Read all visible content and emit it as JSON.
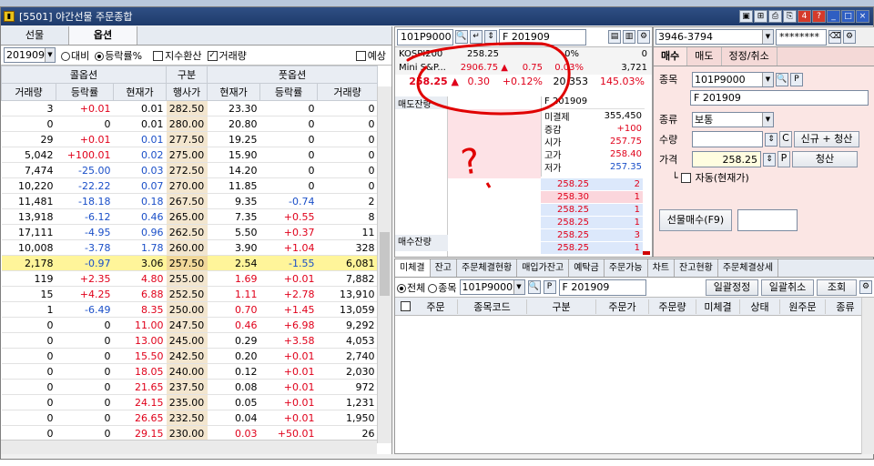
{
  "window": {
    "title": "[5501] 야간선물 주문종합",
    "icon": "app-icon",
    "title_buttons": [
      "▣",
      "⊞",
      "⎙",
      "⎘",
      "4",
      "?",
      "_",
      "□",
      "×"
    ]
  },
  "left": {
    "tabs": [
      "선물",
      "옵션"
    ],
    "month": "201909",
    "radio_daebi": "대비",
    "radio_rate": "등락률%",
    "chk_index": "지수환산",
    "chk_volume": "거래량",
    "chk_expect": "예상",
    "group_headers": {
      "call": "콜옵션",
      "center": "구분",
      "put": "풋옵션"
    },
    "col_headers": [
      "거래량",
      "등락률",
      "현재가",
      "행사가",
      "현재가",
      "등락률",
      "거래량"
    ],
    "rows": [
      [
        "3",
        "+0.01",
        "0.01",
        "282.50",
        "23.30",
        "0",
        "0"
      ],
      [
        "0",
        "0",
        "0.01",
        "280.00",
        "20.80",
        "0",
        "0"
      ],
      [
        "29",
        "+0.01",
        "0.01",
        "277.50",
        "19.25",
        "0",
        "0"
      ],
      [
        "5,042",
        "+100.01",
        "0.02",
        "275.00",
        "15.90",
        "0",
        "0"
      ],
      [
        "7,474",
        "-25.00",
        "0.03",
        "272.50",
        "14.20",
        "0",
        "0"
      ],
      [
        "10,220",
        "-22.22",
        "0.07",
        "270.00",
        "11.85",
        "0",
        "0"
      ],
      [
        "11,481",
        "-18.18",
        "0.18",
        "267.50",
        "9.35",
        "-0.74",
        "2"
      ],
      [
        "13,918",
        "-6.12",
        "0.46",
        "265.00",
        "7.35",
        "+0.55",
        "8"
      ],
      [
        "17,111",
        "-4.95",
        "0.96",
        "262.50",
        "5.50",
        "+0.37",
        "11"
      ],
      [
        "10,008",
        "-3.78",
        "1.78",
        "260.00",
        "3.90",
        "+1.04",
        "328"
      ],
      [
        "2,178",
        "-0.97",
        "3.06",
        "257.50",
        "2.54",
        "-1.55",
        "6,081"
      ],
      [
        "119",
        "+2.35",
        "4.80",
        "255.00",
        "1.69",
        "+0.01",
        "7,882"
      ],
      [
        "15",
        "+4.25",
        "6.88",
        "252.50",
        "1.11",
        "+2.78",
        "13,910"
      ],
      [
        "1",
        "-6.49",
        "8.35",
        "250.00",
        "0.70",
        "+1.45",
        "13,059"
      ],
      [
        "0",
        "0",
        "11.00",
        "247.50",
        "0.46",
        "+6.98",
        "9,292"
      ],
      [
        "0",
        "0",
        "13.00",
        "245.00",
        "0.29",
        "+3.58",
        "4,053"
      ],
      [
        "0",
        "0",
        "15.50",
        "242.50",
        "0.20",
        "+0.01",
        "2,740"
      ],
      [
        "0",
        "0",
        "18.05",
        "240.00",
        "0.12",
        "+0.01",
        "2,030"
      ],
      [
        "0",
        "0",
        "21.65",
        "237.50",
        "0.08",
        "+0.01",
        "972"
      ],
      [
        "0",
        "0",
        "24.15",
        "235.00",
        "0.05",
        "+0.01",
        "1,231"
      ],
      [
        "0",
        "0",
        "26.65",
        "232.50",
        "0.04",
        "+0.01",
        "1,950"
      ],
      [
        "0",
        "0",
        "29.15",
        "230.00",
        "0.03",
        "+50.01",
        "26"
      ]
    ]
  },
  "mid": {
    "code": "101P9000",
    "name": "F 201909",
    "kospi": [
      "KOSPI200",
      "258.25",
      "0%",
      "0"
    ],
    "mini": [
      "Mini S&P...",
      "2906.75 ▲",
      "0.75",
      "0.03%",
      "3,721"
    ],
    "cur": [
      "258.25 ▲",
      "0.30",
      "+0.12%",
      "20,353",
      "145.03%"
    ],
    "sell_rem": "매도잔량",
    "buy_rem": "매수잔량",
    "info_title": "F 201909",
    "info": [
      [
        "미결제",
        "355,450"
      ],
      [
        "증감",
        "+100"
      ],
      [
        "시가",
        "257.75"
      ],
      [
        "고가",
        "258.40"
      ],
      [
        "저가",
        "257.35"
      ]
    ],
    "bids": [
      [
        "258.25",
        "2"
      ],
      [
        "258.30",
        "1"
      ],
      [
        "258.25",
        "1"
      ],
      [
        "258.25",
        "1"
      ],
      [
        "258.25",
        "3"
      ],
      [
        "258.25",
        "1"
      ]
    ]
  },
  "right": {
    "account": "3946-3794",
    "password": "********",
    "tabs": [
      "매수",
      "매도",
      "정정/취소"
    ],
    "lbl_code": "종목",
    "code": "101P9000",
    "name": "F 201909",
    "lbl_kind": "종류",
    "kind": "보통",
    "lbl_qty": "수량",
    "qty": "",
    "c": "C",
    "new_clear": "신규 + 청산",
    "lbl_price": "가격",
    "price": "258.25",
    "p": "P",
    "clear": "청산",
    "auto": "자동(현재가)",
    "buy_btn": "선물매수(F9)"
  },
  "bottom": {
    "tabs": [
      "미체결",
      "잔고",
      "주문체결현황",
      "매입가잔고",
      "예탁금",
      "주문가능",
      "차트",
      "잔고현황",
      "주문체결상세"
    ],
    "all": "전체",
    "item": "종목",
    "code": "101P9000",
    "name": "F 201909",
    "btn1": "일괄정정",
    "btn2": "일괄취소",
    "btn3": "조회",
    "headers": [
      "주문",
      "종목코드",
      "구분",
      "주문가",
      "주문량",
      "미체결",
      "상태",
      "원주문",
      "종류"
    ]
  },
  "annotation": {
    "mark": "?",
    "color": "#e00000"
  }
}
